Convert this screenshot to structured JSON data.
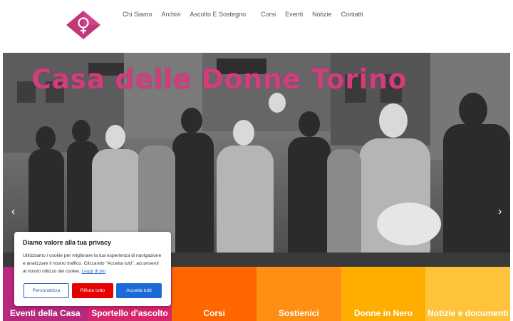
{
  "header": {
    "logo_alt": "Casa delle Donne Torino logo",
    "nav": [
      "Chi Siamo",
      "Archivi",
      "Ascolto E Sostegno",
      "Corsi",
      "Eventi",
      "Notizie",
      "Contatti"
    ]
  },
  "hero": {
    "title": "Casa delle Donne Torino",
    "prev_icon": "chevron-left-icon",
    "next_icon": "chevron-right-icon",
    "prev_glyph": "‹",
    "next_glyph": "›"
  },
  "tiles": [
    {
      "label": "Eventi della Casa",
      "color": "#b7287f"
    },
    {
      "label": "Sportello d'ascolto",
      "color": "#d6256d"
    },
    {
      "label": "Corsi",
      "color": "#ff6600"
    },
    {
      "label": "Sostienici",
      "color": "#ff8f14"
    },
    {
      "label": "Donne in Nero",
      "color": "#ffae00"
    },
    {
      "label": "Notizie e documenti",
      "color": "#ffc33b"
    }
  ],
  "cookie": {
    "title": "Diamo valore alla tua privacy",
    "text": "Utilizziamo i cookie per migliorare la tua esperienza di navigazione e analizzare il nostro traffico. Cliccando \"Accetta tutti\", acconsenti al nostro utilizzo dei cookie.",
    "link": "Leggi di più",
    "customize": "Personalizza",
    "reject": "Rifiuta tutto",
    "accept": "Accetta tutti"
  },
  "colors": {
    "brand_magenta": "#c2377a",
    "accept_blue": "#1d6ad6",
    "reject_red": "#e60000"
  }
}
